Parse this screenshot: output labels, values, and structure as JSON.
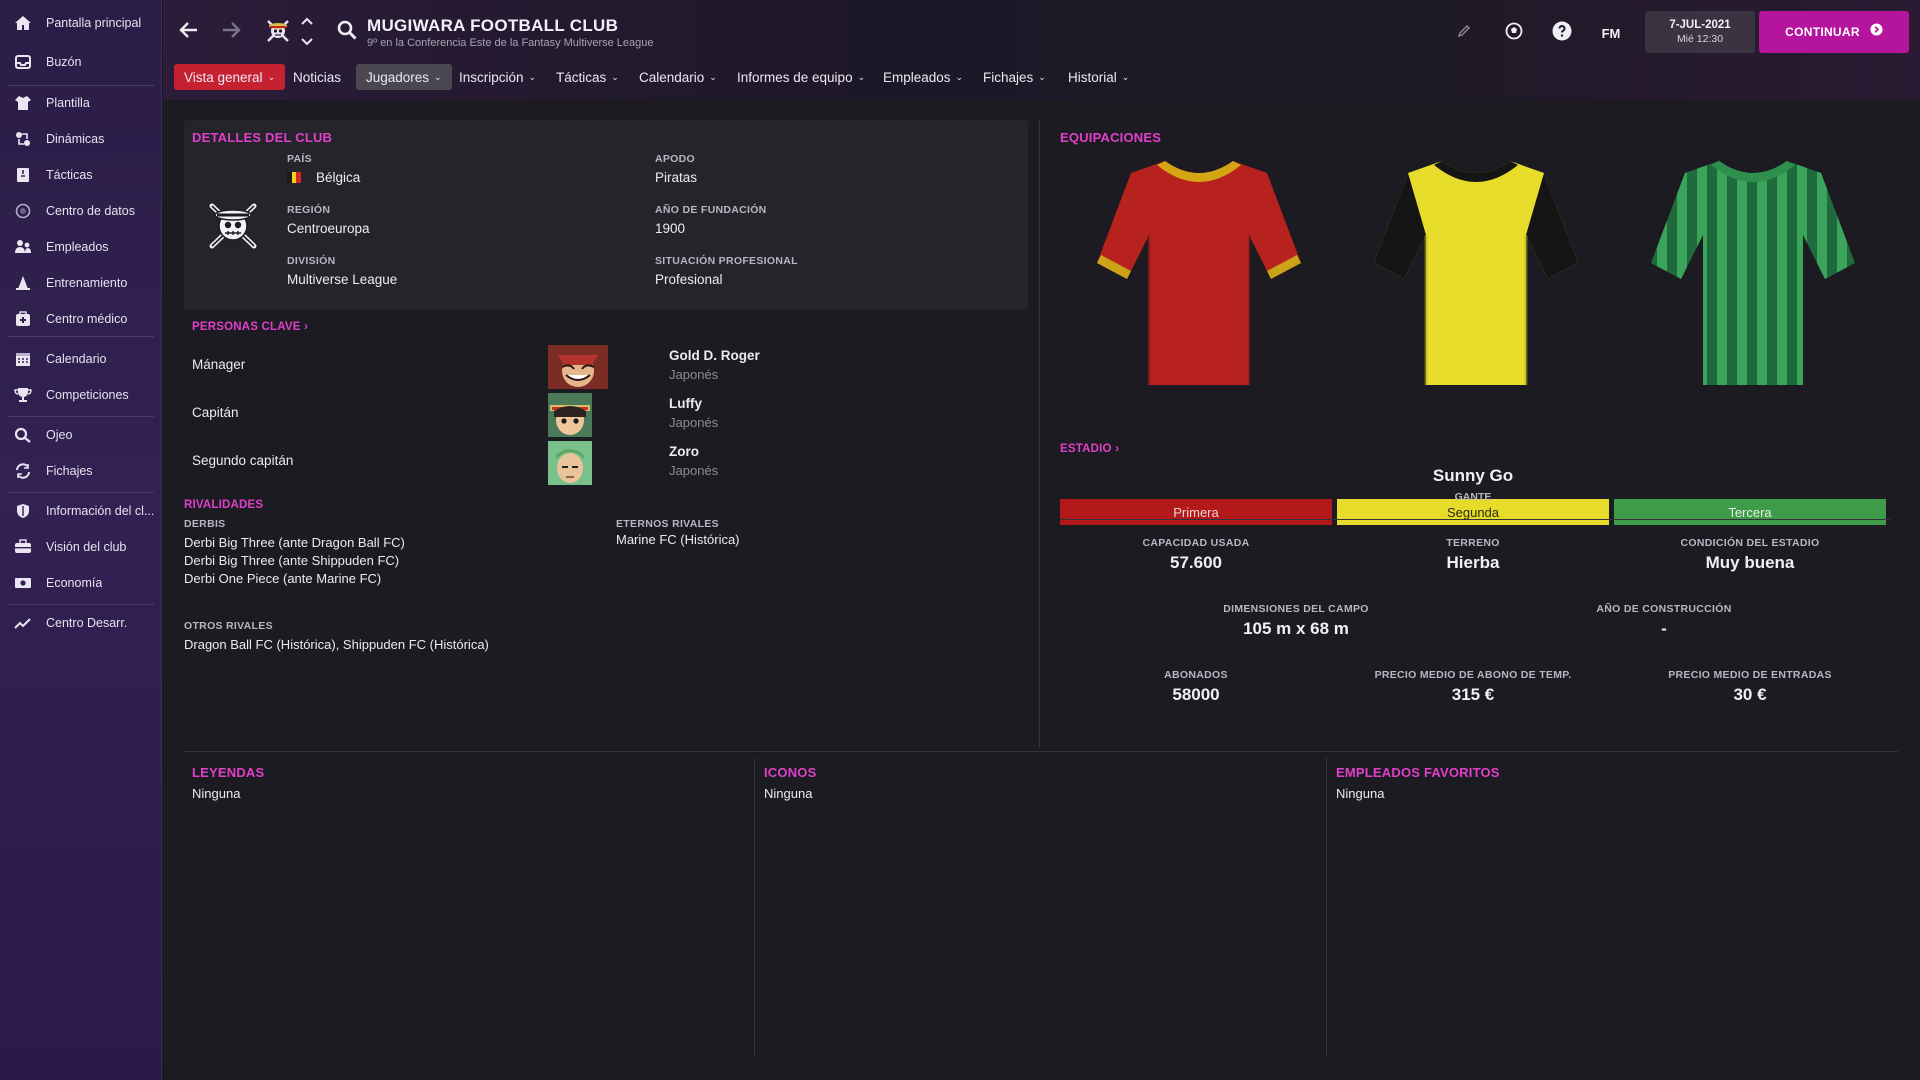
{
  "sidebar": {
    "items": [
      {
        "label": "Pantalla principal",
        "icon": "home-icon"
      },
      {
        "label": "Buzón",
        "icon": "inbox-icon"
      },
      {
        "label": "Plantilla",
        "icon": "shirt-icon"
      },
      {
        "label": "Dinámicas",
        "icon": "dynamics-icon"
      },
      {
        "label": "Tácticas",
        "icon": "tactics-icon"
      },
      {
        "label": "Centro de datos",
        "icon": "data-hub-icon"
      },
      {
        "label": "Empleados",
        "icon": "staff-icon"
      },
      {
        "label": "Entrenamiento",
        "icon": "training-cone-icon"
      },
      {
        "label": "Centro médico",
        "icon": "medical-kit-icon"
      },
      {
        "label": "Calendario",
        "icon": "calendar-icon"
      },
      {
        "label": "Competiciones",
        "icon": "trophy-icon"
      },
      {
        "label": "Ojeo",
        "icon": "scouting-search-icon"
      },
      {
        "label": "Fichajes",
        "icon": "transfers-icon"
      },
      {
        "label": "Información del cl...",
        "icon": "shield-icon"
      },
      {
        "label": "Visión del club",
        "icon": "club-vision-icon"
      },
      {
        "label": "Economía",
        "icon": "finances-icon"
      },
      {
        "label": "Centro Desarr.",
        "icon": "development-icon"
      }
    ]
  },
  "header": {
    "club_name": "MUGIWARA FOOTBALL CLUB",
    "subtitle": "9º en la Conferencia Este de la Fantasy Multiverse League",
    "date": "7-JUL-2021",
    "time": "Mié 12:30",
    "fm_label": "FM",
    "continue_label": "CONTINUAR",
    "accent": "#b5149c"
  },
  "tabs": [
    {
      "label": "Vista general",
      "dropdown": true,
      "state": "active"
    },
    {
      "label": "Noticias",
      "dropdown": false,
      "state": "normal"
    },
    {
      "label": "Jugadores",
      "dropdown": true,
      "state": "hover"
    },
    {
      "label": "Inscripción",
      "dropdown": true,
      "state": "normal"
    },
    {
      "label": "Tácticas",
      "dropdown": true,
      "state": "normal"
    },
    {
      "label": "Calendario",
      "dropdown": true,
      "state": "normal"
    },
    {
      "label": "Informes de equipo",
      "dropdown": true,
      "state": "normal"
    },
    {
      "label": "Empleados",
      "dropdown": true,
      "state": "normal"
    },
    {
      "label": "Fichajes",
      "dropdown": true,
      "state": "normal"
    },
    {
      "label": "Historial",
      "dropdown": true,
      "state": "normal"
    }
  ],
  "club_details": {
    "title": "DETALLES DEL CLUB",
    "country_label": "PAÍS",
    "country": "Bélgica",
    "nickname_label": "APODO",
    "nickname": "Piratas",
    "region_label": "REGIÓN",
    "region": "Centroeuropa",
    "founded_label": "AÑO DE FUNDACIÓN",
    "founded": "1900",
    "division_label": "DIVISIÓN",
    "division": "Multiverse League",
    "status_label": "SITUACIÓN PROFESIONAL",
    "status": "Profesional"
  },
  "key_people": {
    "title": "PERSONAS CLAVE",
    "rows": [
      {
        "role": "Mánager",
        "name": "Gold D. Roger",
        "nationality": "Japonés"
      },
      {
        "role": "Capitán",
        "name": "Luffy",
        "nationality": "Japonés"
      },
      {
        "role": "Segundo capitán",
        "name": "Zoro",
        "nationality": "Japonés"
      }
    ]
  },
  "rivalries": {
    "title": "RIVALIDADES",
    "derbies_label": "DERBIS",
    "derbies": [
      "Derbi Big Three (ante Dragon Ball FC)",
      "Derbi Big Three (ante Shippuden FC)",
      "Derbi One Piece (ante Marine FC)"
    ],
    "eternal_label": "ETERNOS RIVALES",
    "eternal": "Marine FC (Histórica)",
    "others_label": "OTROS RIVALES",
    "others": "Dragon Ball FC (Histórica), Shippuden FC (Histórica)"
  },
  "kits": {
    "title": "EQUIPACIONES",
    "items": [
      {
        "label": "Primera",
        "bar_color": "#b3191b",
        "text_color": "#f2d3d3"
      },
      {
        "label": "Segunda",
        "bar_color": "#e8dc2a",
        "text_color": "#2a2a10"
      },
      {
        "label": "Tercera",
        "bar_color": "#3d9b4a",
        "text_color": "#e4f3e4"
      }
    ]
  },
  "stadium": {
    "title": "ESTADIO",
    "name": "Sunny Go",
    "size": "GANTE",
    "stats": [
      {
        "label": "CAPACIDAD USADA",
        "value": "57.600"
      },
      {
        "label": "TERRENO",
        "value": "Hierba"
      },
      {
        "label": "CONDICIÓN DEL ESTADIO",
        "value": "Muy buena"
      },
      {
        "label": "DIMENSIONES DEL CAMPO",
        "value": "105 m x 68 m"
      },
      {
        "label": "AÑO DE CONSTRUCCIÓN",
        "value": "-"
      },
      {
        "label": "ABONADOS",
        "value": "58000"
      },
      {
        "label": "PRECIO MEDIO DE ABONO DE TEMP.",
        "value": "315 €"
      },
      {
        "label": "PRECIO MEDIO DE ENTRADAS",
        "value": "30 €"
      }
    ]
  },
  "legends": {
    "title": "LEYENDAS",
    "value": "Ninguna"
  },
  "icons": {
    "title": "ICONOS",
    "value": "Ninguna"
  },
  "fav_staff": {
    "title": "EMPLEADOS FAVORITOS",
    "value": "Ninguna"
  }
}
